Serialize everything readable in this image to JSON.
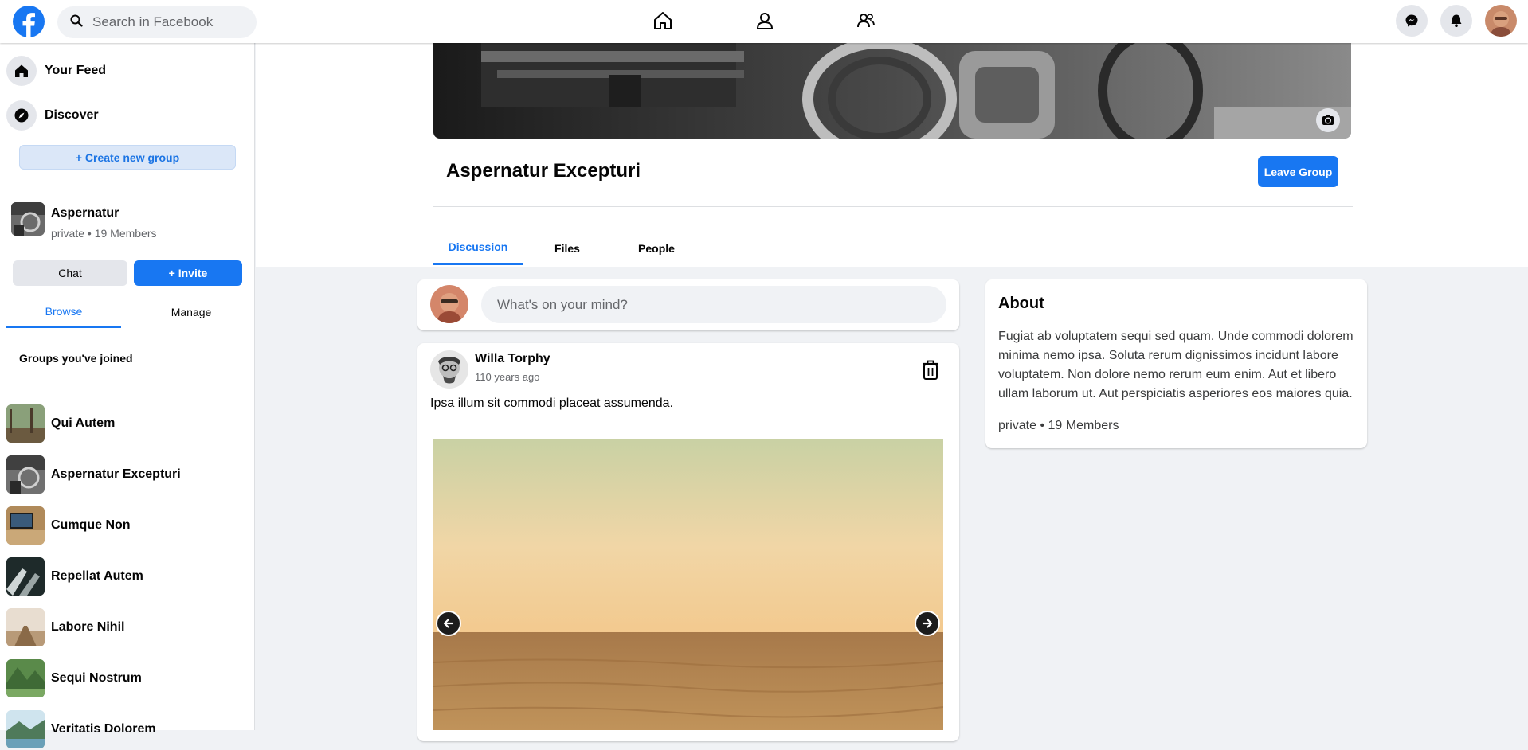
{
  "topbar": {
    "search_placeholder": "Search in Facebook",
    "nav_icons": [
      "home-icon",
      "profile-icon",
      "groups-icon"
    ],
    "right_icons": [
      "messenger-icon",
      "bell-icon",
      "avatar"
    ]
  },
  "sidebar": {
    "links": [
      {
        "label": "Your Feed",
        "icon": "home-icon"
      },
      {
        "label": "Discover",
        "icon": "compass-icon"
      }
    ],
    "create_button": "+ Create new group",
    "current_group": {
      "name": "Aspernatur",
      "meta": "private • 19 Members"
    },
    "chat_button": "Chat",
    "invite_button": "+ Invite",
    "tabs": [
      {
        "label": "Browse",
        "active": true
      },
      {
        "label": "Manage",
        "active": false
      }
    ],
    "joined_title": "Groups you've joined",
    "groups": [
      {
        "name": "Qui Autem"
      },
      {
        "name": "Aspernatur Excepturi"
      },
      {
        "name": "Cumque Non"
      },
      {
        "name": "Repellat Autem"
      },
      {
        "name": "Labore Nihil"
      },
      {
        "name": "Sequi Nostrum"
      },
      {
        "name": "Veritatis Dolorem"
      }
    ]
  },
  "group": {
    "title": "Aspernatur Excepturi",
    "leave_button": "Leave Group",
    "tabs": [
      {
        "label": "Discussion",
        "active": true
      },
      {
        "label": "Files",
        "active": false
      },
      {
        "label": "People",
        "active": false
      }
    ]
  },
  "composer": {
    "placeholder": "What's on your mind?"
  },
  "post": {
    "author": "Willa Torphy",
    "time": "110 years ago",
    "text": "Ipsa illum sit commodi placeat assumenda."
  },
  "about": {
    "title": "About",
    "text": "Fugiat ab voluptatem sequi sed quam. Unde commodi dolorem minima nemo ipsa. Soluta rerum dignissimos incidunt labore voluptatem. Non dolore nemo rerum eum enim. Aut et libero ullam laborum ut. Aut perspiciatis asperiores eos maiores quia.",
    "meta": "private • 19 Members"
  },
  "colors": {
    "accent": "#1877f2",
    "page_bg": "#f0f2f5"
  }
}
